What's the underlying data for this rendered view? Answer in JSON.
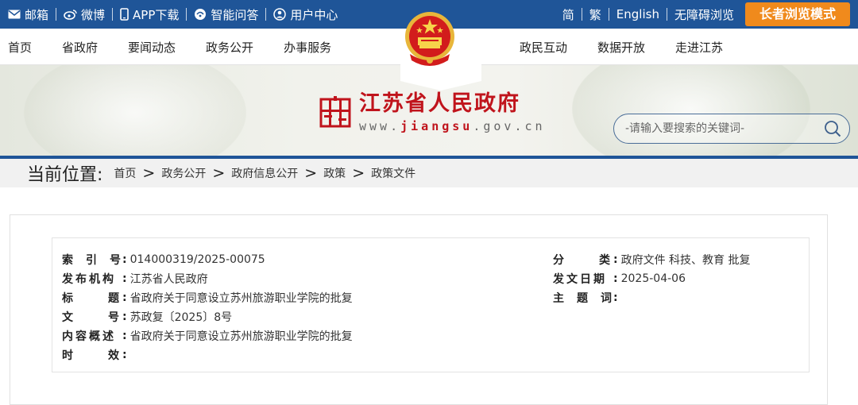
{
  "topbar": {
    "left": [
      {
        "icon": "mail-icon",
        "label": "邮箱"
      },
      {
        "icon": "weibo-icon",
        "label": "微博"
      },
      {
        "icon": "phone-icon",
        "label": "APP下载"
      },
      {
        "icon": "chat-icon",
        "label": "智能问答"
      },
      {
        "icon": "user-icon",
        "label": "用户中心"
      }
    ],
    "right": [
      "简",
      "繁",
      "English",
      "无障碍浏览"
    ],
    "elder_mode": "长者浏览模式"
  },
  "nav": {
    "left": [
      "首页",
      "省政府",
      "要闻动态",
      "政务公开",
      "办事服务"
    ],
    "right": [
      "政民互动",
      "数据开放",
      "走进江苏"
    ]
  },
  "site": {
    "name": "江苏省人民政府",
    "url_prefix": "www.",
    "url_domain": "jiangsu",
    "url_suffix": ".gov.cn"
  },
  "search": {
    "placeholder": "-请输入要搜索的关键词-"
  },
  "breadcrumb": {
    "title": "当前位置:",
    "items": [
      "首页",
      "政务公开",
      "政府信息公开",
      "政策",
      "政策文件"
    ]
  },
  "meta": {
    "index_label": "索引号",
    "index_value": "014000319/2025-00075",
    "issuer_label": "发布机构",
    "issuer_value": "江苏省人民政府",
    "title_label": "标题",
    "title_value": "省政府关于同意设立苏州旅游职业学院的批复",
    "docno_label": "文号",
    "docno_value": "苏政复〔2025〕8号",
    "summary_label": "内容概述",
    "summary_value": "省政府关于同意设立苏州旅游职业学院的批复",
    "validity_label": "时效",
    "validity_value": "",
    "category_label": "分类",
    "category_value": "政府文件 科技、教育 批复",
    "date_label": "发文日期",
    "date_value": "2025-04-06",
    "keywords_label": "主题词",
    "keywords_value": ""
  },
  "colors": {
    "topbar": "#1f5598",
    "elder_button": "#f08a1c",
    "brand_red": "#c0141c"
  }
}
